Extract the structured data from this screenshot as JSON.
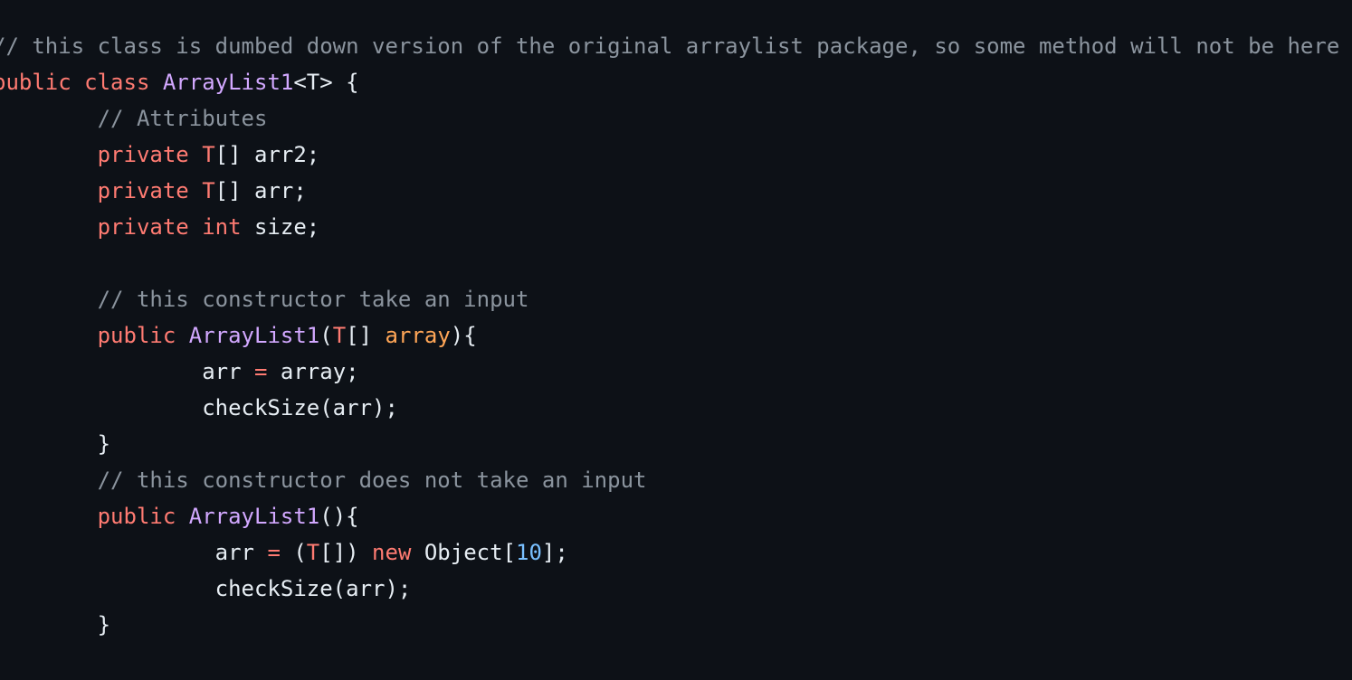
{
  "theme": {
    "background": "#0d1117",
    "colors": {
      "plain": "#e6edf3",
      "comment": "#8b949e",
      "keyword": "#ff7b72",
      "entity": "#d2a8ff",
      "param": "#ffa657",
      "number": "#79c0ff"
    }
  },
  "code": {
    "language": "java",
    "lines": [
      [
        {
          "t": "// this class is dumbed down version of the original arraylist package, so some method will not be here",
          "c": "comment"
        }
      ],
      [
        {
          "t": "public ",
          "c": "keyword"
        },
        {
          "t": "class ",
          "c": "keyword"
        },
        {
          "t": "ArrayList1",
          "c": "entity"
        },
        {
          "t": "<T> {",
          "c": "plain"
        }
      ],
      [
        {
          "t": "        // Attributes",
          "c": "comment"
        }
      ],
      [
        {
          "t": "        private ",
          "c": "keyword"
        },
        {
          "t": "T",
          "c": "keyword"
        },
        {
          "t": "[] arr2;",
          "c": "plain"
        }
      ],
      [
        {
          "t": "        private ",
          "c": "keyword"
        },
        {
          "t": "T",
          "c": "keyword"
        },
        {
          "t": "[] arr;",
          "c": "plain"
        }
      ],
      [
        {
          "t": "        private ",
          "c": "keyword"
        },
        {
          "t": "int ",
          "c": "keyword"
        },
        {
          "t": "size;",
          "c": "plain"
        }
      ],
      [],
      [
        {
          "t": "        // this constructor take an input",
          "c": "comment"
        }
      ],
      [
        {
          "t": "        public ",
          "c": "keyword"
        },
        {
          "t": "ArrayList1",
          "c": "entity"
        },
        {
          "t": "(",
          "c": "plain"
        },
        {
          "t": "T",
          "c": "keyword"
        },
        {
          "t": "[] ",
          "c": "plain"
        },
        {
          "t": "array",
          "c": "param"
        },
        {
          "t": "){",
          "c": "plain"
        }
      ],
      [
        {
          "t": "                arr ",
          "c": "plain"
        },
        {
          "t": "= ",
          "c": "keyword"
        },
        {
          "t": "array;",
          "c": "plain"
        }
      ],
      [
        {
          "t": "                checkSize(arr);",
          "c": "plain"
        }
      ],
      [
        {
          "t": "        }",
          "c": "plain"
        }
      ],
      [
        {
          "t": "        // this constructor does not take an input",
          "c": "comment"
        }
      ],
      [
        {
          "t": "        public ",
          "c": "keyword"
        },
        {
          "t": "ArrayList1",
          "c": "entity"
        },
        {
          "t": "(){",
          "c": "plain"
        }
      ],
      [
        {
          "t": "                 arr ",
          "c": "plain"
        },
        {
          "t": "= ",
          "c": "keyword"
        },
        {
          "t": "(",
          "c": "plain"
        },
        {
          "t": "T",
          "c": "keyword"
        },
        {
          "t": "[]) ",
          "c": "plain"
        },
        {
          "t": "new ",
          "c": "keyword"
        },
        {
          "t": "Object[",
          "c": "plain"
        },
        {
          "t": "10",
          "c": "number"
        },
        {
          "t": "];",
          "c": "plain"
        }
      ],
      [
        {
          "t": "                 checkSize(arr);",
          "c": "plain"
        }
      ],
      [
        {
          "t": "        }",
          "c": "plain"
        }
      ]
    ]
  }
}
